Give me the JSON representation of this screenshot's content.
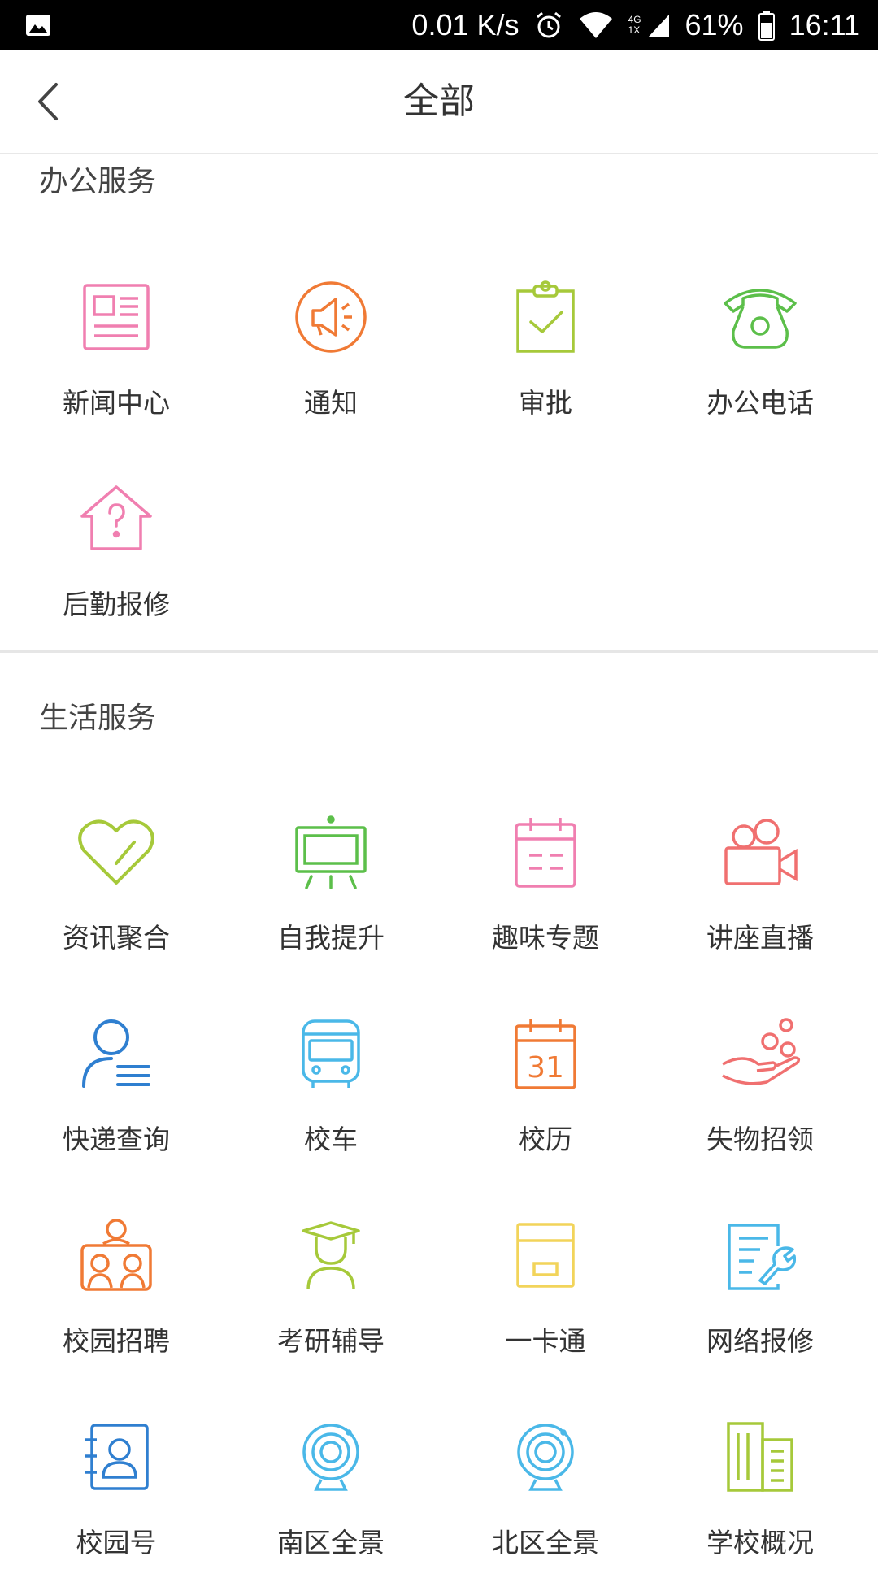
{
  "status_bar": {
    "speed": "0.01 K/s",
    "network": "4G 1X",
    "battery": "61%",
    "time": "16:11"
  },
  "header": {
    "title": "全部"
  },
  "sections": [
    {
      "title": "办公服务",
      "items": [
        {
          "label": "新闻中心",
          "icon": "newspaper-icon",
          "color": "#f07fb0"
        },
        {
          "label": "通知",
          "icon": "megaphone-icon",
          "color": "#f07a35"
        },
        {
          "label": "审批",
          "icon": "clipboard-check-icon",
          "color": "#a6c93a"
        },
        {
          "label": "办公电话",
          "icon": "telephone-icon",
          "color": "#5cbf4a"
        },
        {
          "label": "后勤报修",
          "icon": "house-question-icon",
          "color": "#f07fb0"
        }
      ]
    },
    {
      "title": "生活服务",
      "items": [
        {
          "label": "资讯聚合",
          "icon": "heart-icon",
          "color": "#a6c93a"
        },
        {
          "label": "自我提升",
          "icon": "blackboard-icon",
          "color": "#5cbf4a"
        },
        {
          "label": "趣味专题",
          "icon": "calendar-icon",
          "color": "#f07fb0"
        },
        {
          "label": "讲座直播",
          "icon": "video-camera-icon",
          "color": "#f07070"
        },
        {
          "label": "快递查询",
          "icon": "person-list-icon",
          "color": "#2f7fd0"
        },
        {
          "label": "校车",
          "icon": "bus-icon",
          "color": "#4ab8e8"
        },
        {
          "label": "校历",
          "icon": "calendar-31-icon",
          "color": "#f07a35"
        },
        {
          "label": "失物招领",
          "icon": "hand-coins-icon",
          "color": "#f07070"
        },
        {
          "label": "校园招聘",
          "icon": "recruitment-icon",
          "color": "#f07a35"
        },
        {
          "label": "考研辅导",
          "icon": "graduate-icon",
          "color": "#a6c93a"
        },
        {
          "label": "一卡通",
          "icon": "card-icon",
          "color": "#f2d45a"
        },
        {
          "label": "网络报修",
          "icon": "document-wrench-icon",
          "color": "#4ab8e8"
        },
        {
          "label": "校园号",
          "icon": "contact-card-icon",
          "color": "#2f7fd0"
        },
        {
          "label": "南区全景",
          "icon": "webcam-icon",
          "color": "#4ab8e8"
        },
        {
          "label": "北区全景",
          "icon": "webcam-icon",
          "color": "#4ab8e8"
        },
        {
          "label": "学校概况",
          "icon": "buildings-icon",
          "color": "#a6c93a"
        }
      ]
    }
  ]
}
